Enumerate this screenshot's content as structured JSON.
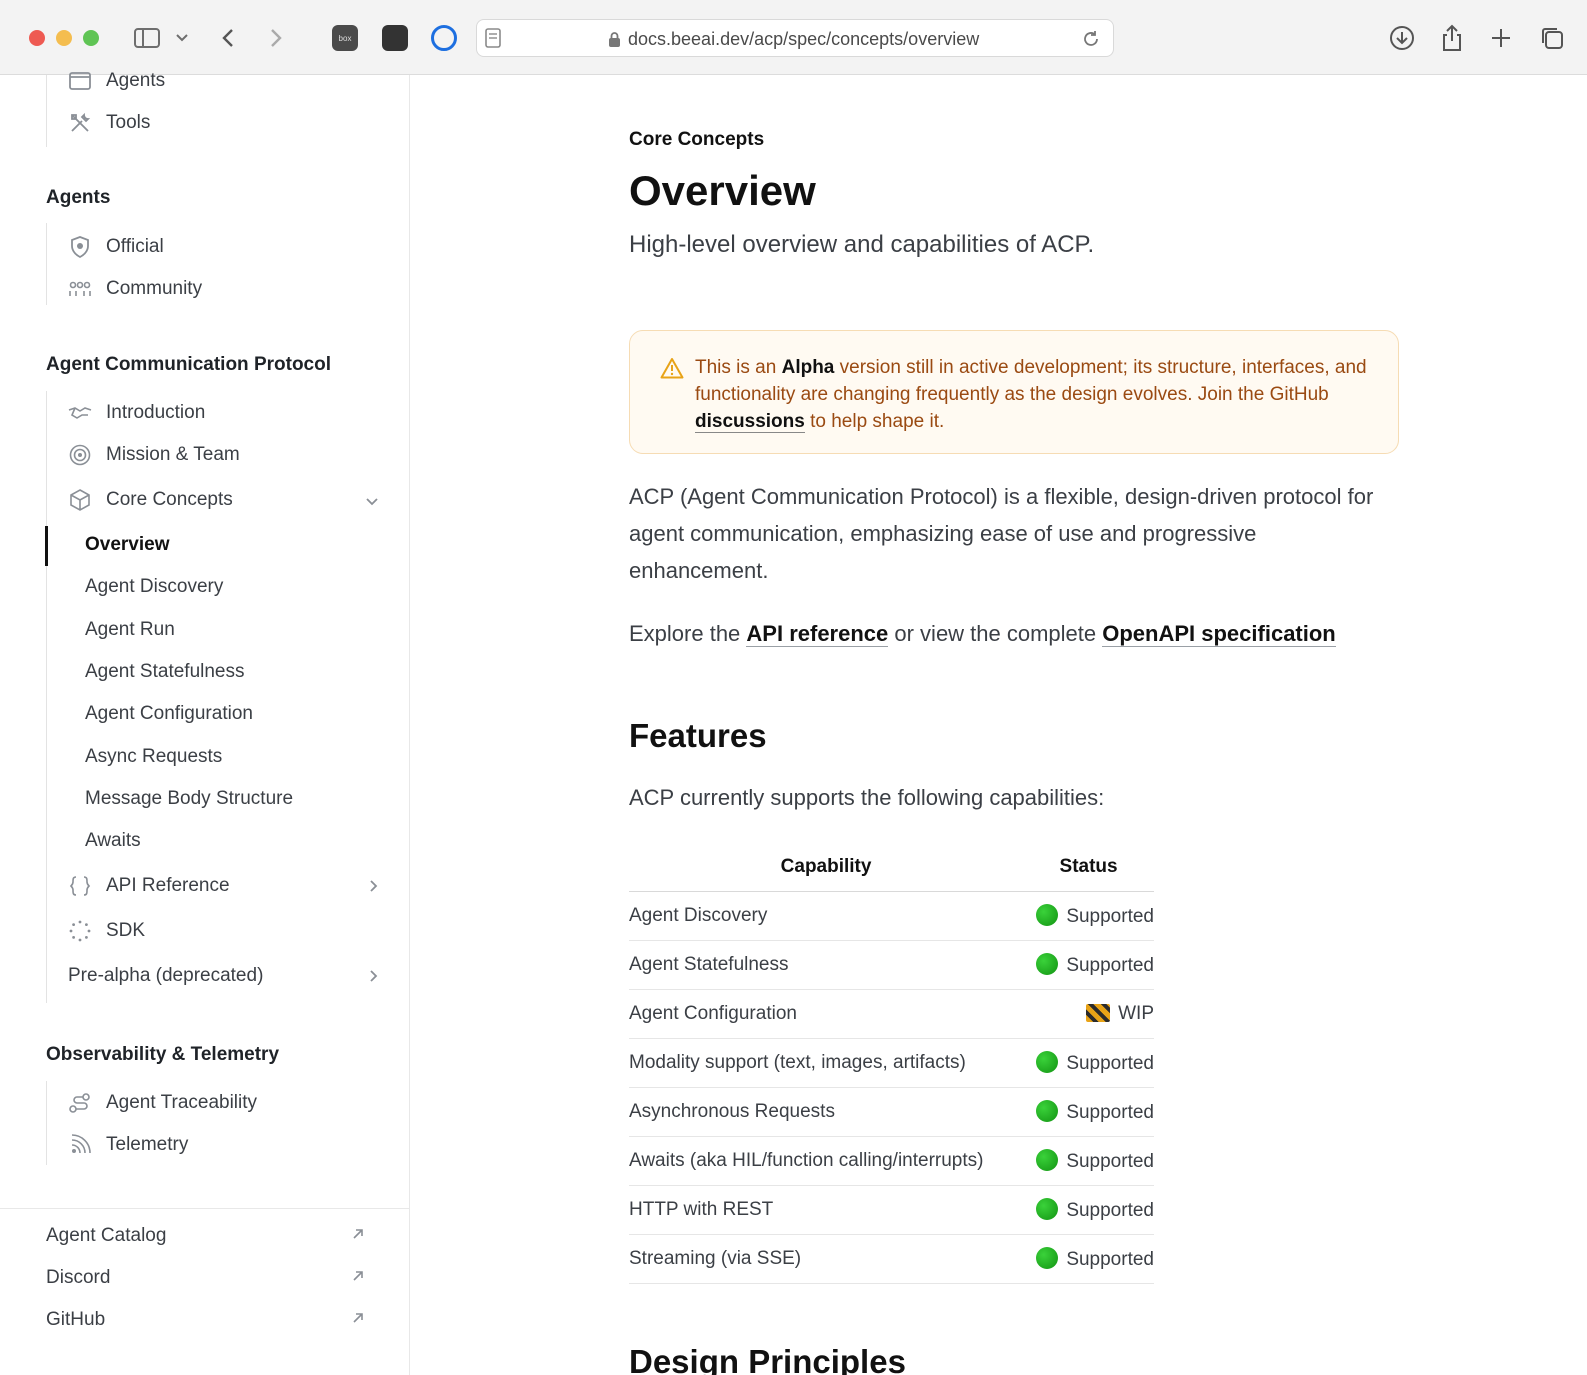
{
  "browser": {
    "url": "docs.beeai.dev/acp/spec/concepts/overview",
    "ext1_label": "box"
  },
  "sidebar": {
    "top_items": [
      {
        "label": "Agents",
        "icon": "window-icon"
      },
      {
        "label": "Tools",
        "icon": "tools-icon"
      }
    ],
    "agents_group": {
      "title": "Agents",
      "items": [
        {
          "label": "Official",
          "icon": "shield-icon"
        },
        {
          "label": "Community",
          "icon": "people-icon"
        }
      ]
    },
    "acp_group": {
      "title": "Agent Communication Protocol",
      "items": [
        {
          "label": "Introduction",
          "icon": "handshake-icon"
        },
        {
          "label": "Mission & Team",
          "icon": "target-icon"
        },
        {
          "label": "Core Concepts",
          "icon": "cube-icon"
        }
      ],
      "core_sub": [
        "Overview",
        "Agent Discovery",
        "Agent Run",
        "Agent Statefulness",
        "Agent Configuration",
        "Async Requests",
        "Message Body Structure",
        "Awaits"
      ],
      "after": [
        {
          "label": "API Reference",
          "icon": "braces-icon"
        },
        {
          "label": "SDK",
          "icon": "loader-icon"
        },
        {
          "label": "Pre-alpha (deprecated)"
        }
      ]
    },
    "obs_group": {
      "title": "Observability & Telemetry",
      "items": [
        {
          "label": "Agent Traceability",
          "icon": "route-icon"
        },
        {
          "label": "Telemetry",
          "icon": "signal-icon"
        }
      ]
    },
    "footer_links": [
      "Agent Catalog",
      "Discord",
      "GitHub"
    ]
  },
  "main": {
    "eyebrow": "Core Concepts",
    "title": "Overview",
    "subtitle": "High-level overview and capabilities of ACP.",
    "callout": {
      "pre": "This is an ",
      "bold": "Alpha",
      "mid": " version still in active development; its structure, interfaces, and functionality are changing frequently as the design evolves. Join the GitHub ",
      "link": "discussions",
      "post": " to help shape it."
    },
    "intro": "ACP (Agent Communication Protocol) is a flexible, design-driven protocol for agent communication, emphasizing ease of use and progressive enhancement.",
    "explore": {
      "pre": "Explore the ",
      "link1": "API reference",
      "mid": " or view the complete ",
      "link2": "OpenAPI specification"
    },
    "features_title": "Features",
    "features_intro": "ACP currently supports the following capabilities:",
    "table": {
      "headers": [
        "Capability",
        "Status"
      ],
      "rows": [
        {
          "capability": "Agent Discovery",
          "status": "Supported",
          "icon": "green-circle-icon"
        },
        {
          "capability": "Agent Statefulness",
          "status": "Supported",
          "icon": "green-circle-icon"
        },
        {
          "capability": "Agent Configuration",
          "status": "WIP",
          "icon": "construction-icon"
        },
        {
          "capability": "Modality support (text, images, artifacts)",
          "status": "Supported",
          "icon": "green-circle-icon"
        },
        {
          "capability": "Asynchronous Requests",
          "status": "Supported",
          "icon": "green-circle-icon"
        },
        {
          "capability": "Awaits (aka HIL/function calling/interrupts)",
          "status": "Supported",
          "icon": "green-circle-icon"
        },
        {
          "capability": "HTTP with REST",
          "status": "Supported",
          "icon": "green-circle-icon"
        },
        {
          "capability": "Streaming (via SSE)",
          "status": "Supported",
          "icon": "green-circle-icon"
        }
      ]
    },
    "next_heading": "Design Principles"
  }
}
